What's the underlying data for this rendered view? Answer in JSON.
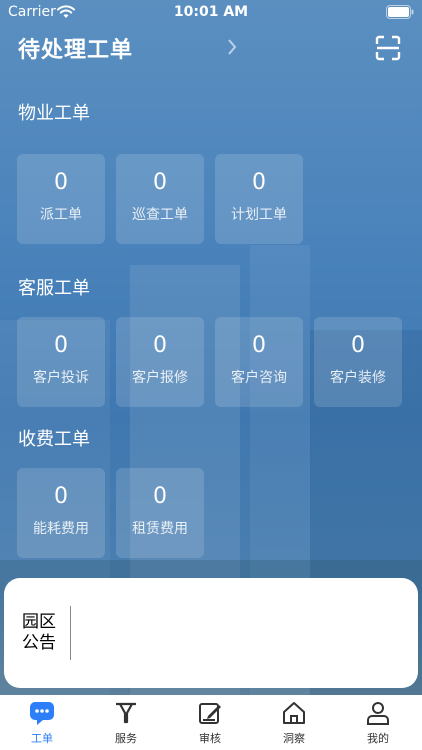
{
  "status": {
    "carrier": "Carrier",
    "time": "10:01 AM"
  },
  "header": {
    "title": "待处理工单"
  },
  "sections": [
    {
      "title": "物业工单",
      "tiles": [
        {
          "count": "0",
          "label": "派工单"
        },
        {
          "count": "0",
          "label": "巡查工单"
        },
        {
          "count": "0",
          "label": "计划工单"
        }
      ]
    },
    {
      "title": "客服工单",
      "tiles": [
        {
          "count": "0",
          "label": "客户投诉"
        },
        {
          "count": "0",
          "label": "客户报修"
        },
        {
          "count": "0",
          "label": "客户咨询"
        },
        {
          "count": "0",
          "label": "客户装修"
        }
      ]
    },
    {
      "title": "收费工单",
      "tiles": [
        {
          "count": "0",
          "label": "能耗费用"
        },
        {
          "count": "0",
          "label": "租赁费用"
        }
      ]
    }
  ],
  "notice": {
    "label": "园区公告"
  },
  "tabbar": {
    "items": [
      {
        "label": "工单",
        "icon": "chat-bubble-icon",
        "active": true
      },
      {
        "label": "服务",
        "icon": "filter-icon",
        "active": false
      },
      {
        "label": "审核",
        "icon": "edit-doc-icon",
        "active": false
      },
      {
        "label": "洞察",
        "icon": "home-icon",
        "active": false
      },
      {
        "label": "我的",
        "icon": "person-icon",
        "active": false
      }
    ],
    "active_color": "#2d7ff9",
    "inactive_color": "#333333"
  },
  "colors": {
    "background_blue": "#4a83bb",
    "tile_bg": "rgba(255,255,255,0.14)"
  }
}
